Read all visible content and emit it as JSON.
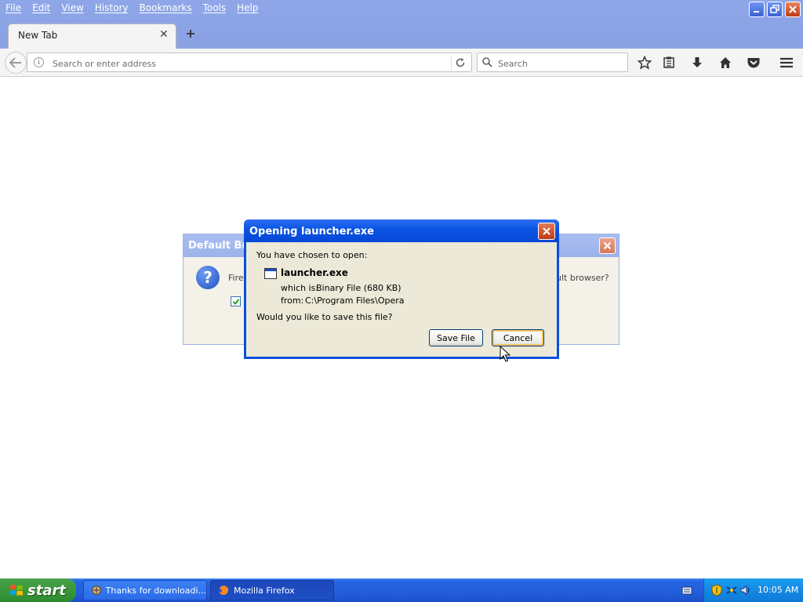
{
  "menu": [
    "File",
    "Edit",
    "View",
    "History",
    "Bookmarks",
    "Tools",
    "Help"
  ],
  "tab": {
    "title": "New Tab"
  },
  "urlbar": {
    "placeholder": "Search or enter address"
  },
  "searchbar": {
    "placeholder": "Search"
  },
  "bg_dialog": {
    "title": "Default Brow",
    "text_left": "Firef",
    "text_right": "ult browser?"
  },
  "main_dialog": {
    "title": "Opening launcher.exe",
    "prompt": "You have chosen to open:",
    "file_name": "launcher.exe",
    "type_label": "which is:",
    "type_value": "Binary File (680 KB)",
    "from_label": "from:",
    "from_value": "C:\\Program Files\\Opera",
    "question": "Would you like to save this file?",
    "save_label": "Save File",
    "cancel_label": "Cancel"
  },
  "taskbar": {
    "start_label": "start",
    "tasks": [
      {
        "label": "Thanks for downloadi..."
      },
      {
        "label": "Mozilla Firefox"
      }
    ],
    "clock": "10:05 AM"
  }
}
